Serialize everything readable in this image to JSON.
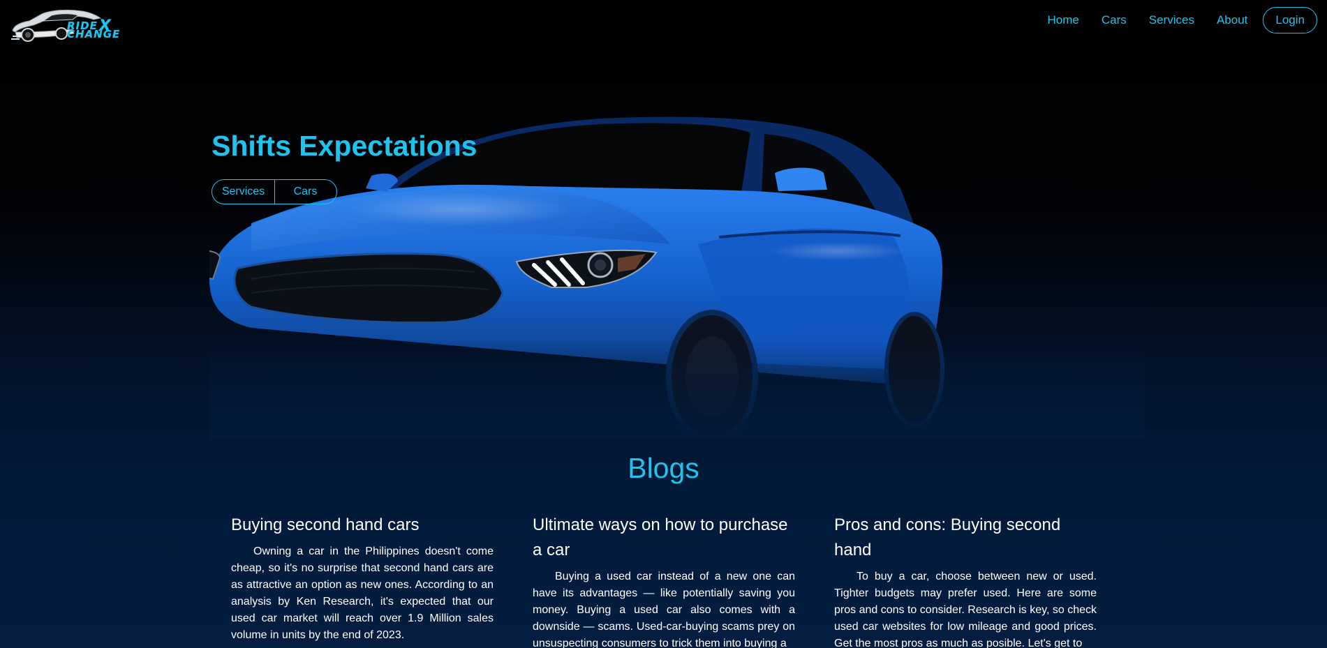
{
  "brand": {
    "logo_line1": "RIDE",
    "logo_x": "X",
    "logo_line2": "CHANGE",
    "accent_color": "#1fc4ee"
  },
  "nav": {
    "items": [
      "Home",
      "Cars",
      "Services",
      "About"
    ],
    "login_label": "Login"
  },
  "hero": {
    "title": "Shifts Expectations",
    "buttons": [
      "Services",
      "Cars"
    ],
    "car_color": "#1466d8"
  },
  "blogs": {
    "title": "Blogs",
    "posts": [
      {
        "title": "Buying second hand cars",
        "body": "Owning a car in the Philippines doesn't come cheap, so it's no surprise that second hand cars are as attractive an option as new ones. According to an analysis by Ken Research, it's expected that our used car market will reach over 1.9 Million sales volume in units by the end of 2023."
      },
      {
        "title": "Ultimate ways on how to purchase a car",
        "body": "Buying a used car instead of a new one can have its advantages — like potentially saving you money. Buying a used car also comes with a downside — scams. Used-car-buying scams prey on unsuspecting consumers to trick them into buying a"
      },
      {
        "title": "Pros and cons: Buying second hand",
        "body": "To buy a car, choose between new or used. Tighter budgets may prefer used. Here are some pros and cons to consider. Research is key, so check used car websites for low mileage and good prices. Get the most pros as much as posible. Let's get to"
      }
    ]
  }
}
